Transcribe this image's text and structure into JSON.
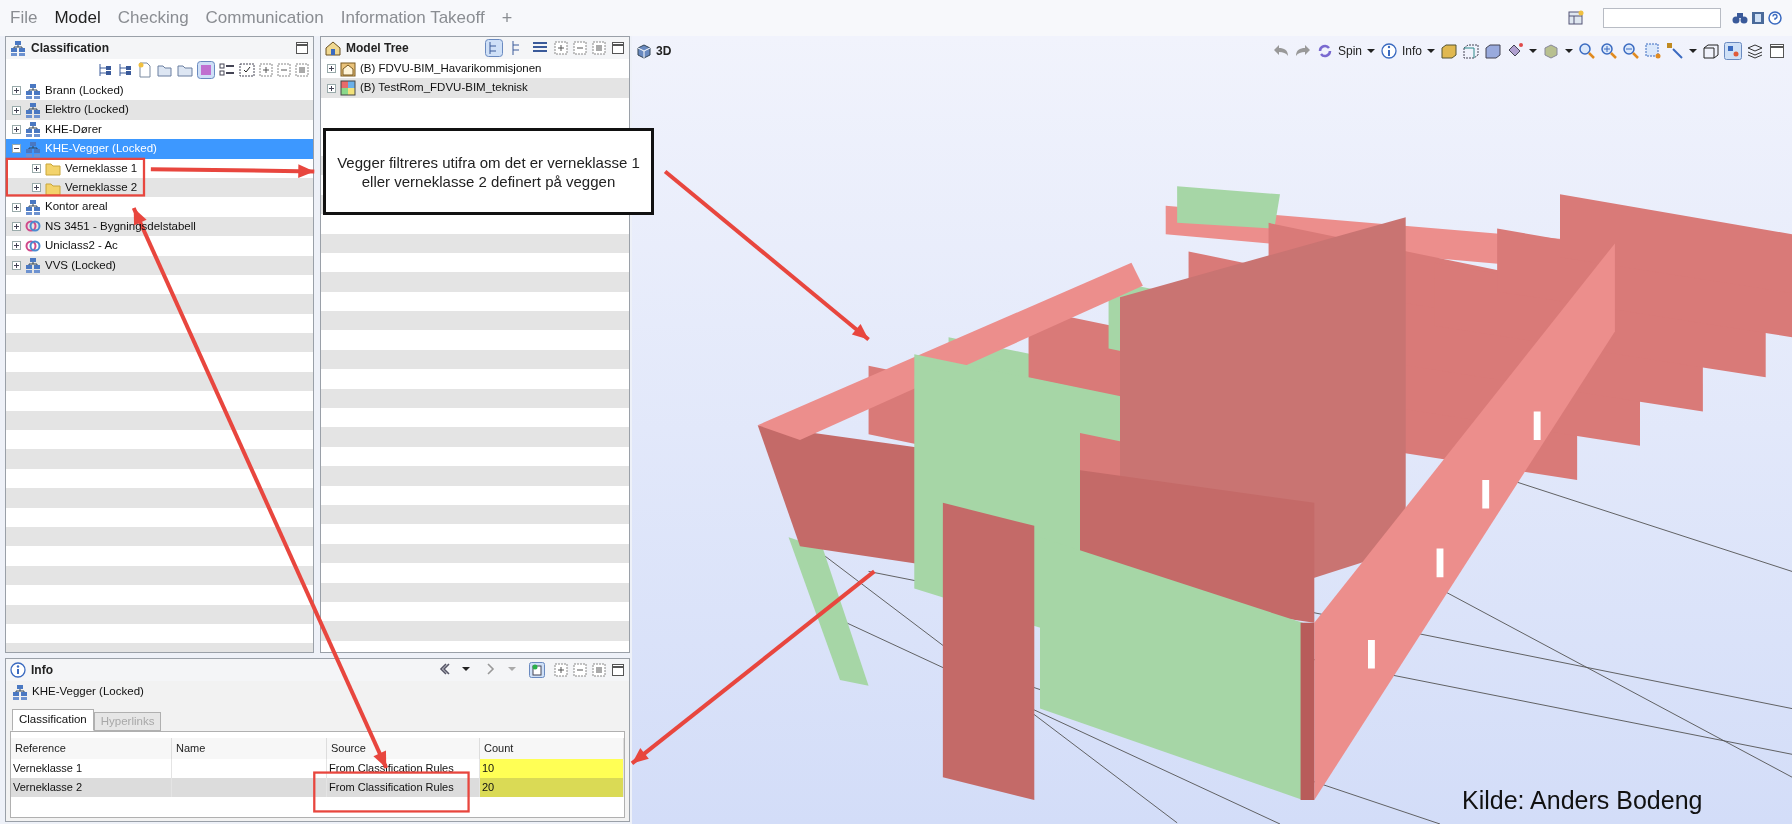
{
  "menu": [
    {
      "label": "File",
      "selected": false
    },
    {
      "label": "Model",
      "selected": true
    },
    {
      "label": "Checking",
      "selected": false
    },
    {
      "label": "Communication",
      "selected": false
    },
    {
      "label": "Information Takeoff",
      "selected": false
    }
  ],
  "menu_add": "+",
  "classification": {
    "title": "Classification",
    "items": [
      {
        "label": "Brann (Locked)",
        "kind": "classification",
        "expanded": false,
        "selected": false
      },
      {
        "label": "Elektro (Locked)",
        "kind": "classification",
        "expanded": false,
        "selected": false
      },
      {
        "label": "KHE-Dører",
        "kind": "classification",
        "expanded": false,
        "selected": false
      },
      {
        "label": "KHE-Vegger (Locked)",
        "kind": "classification",
        "expanded": true,
        "selected": true,
        "children": [
          {
            "label": "Verneklasse 1",
            "kind": "folder",
            "expanded": false,
            "selected": false
          },
          {
            "label": "Verneklasse 2",
            "kind": "folder",
            "expanded": false,
            "selected": false
          }
        ]
      },
      {
        "label": "Kontor areal",
        "kind": "classification",
        "expanded": false,
        "selected": false
      },
      {
        "label": "NS 3451 - Bygningsdelstabell",
        "kind": "standard",
        "expanded": false,
        "selected": false
      },
      {
        "label": "Uniclass2 - Ac",
        "kind": "standard",
        "expanded": false,
        "selected": false
      },
      {
        "label": "VVS (Locked)",
        "kind": "classification",
        "expanded": false,
        "selected": false
      }
    ]
  },
  "model_tree": {
    "title": "Model Tree",
    "items": [
      {
        "label": "(B) FDVU-BIM_Havarikommisjonen",
        "kind": "building",
        "expanded": false
      },
      {
        "label": "(B) TestRom_FDVU-BIM_teknisk",
        "kind": "rooms",
        "expanded": false
      }
    ]
  },
  "view_3d": {
    "title": "3D",
    "toolbar": [
      {
        "label": "Spin",
        "dropdown": true
      },
      {
        "label": "Info",
        "dropdown": true
      }
    ]
  },
  "callout": "Vegger filtreres utifra om det er verneklasse 1 eller verneklasse 2 definert på veggen",
  "info": {
    "title": "Info",
    "subject": "KHE-Vegger (Locked)",
    "tabs": [
      {
        "label": "Classification",
        "selected": true,
        "disabled": false
      },
      {
        "label": "Hyperlinks",
        "selected": false,
        "disabled": true
      }
    ],
    "columns": [
      "Reference",
      "Name",
      "Source",
      "Count"
    ],
    "rows": [
      {
        "cells": [
          "Verneklasse 1",
          "",
          "From Classification Rules",
          "10"
        ],
        "highlighted": true
      },
      {
        "cells": [
          "Verneklasse 2",
          "",
          "From Classification Rules",
          "20"
        ],
        "highlighted": true
      }
    ]
  },
  "credit": "Kilde: Anders Bodeng"
}
